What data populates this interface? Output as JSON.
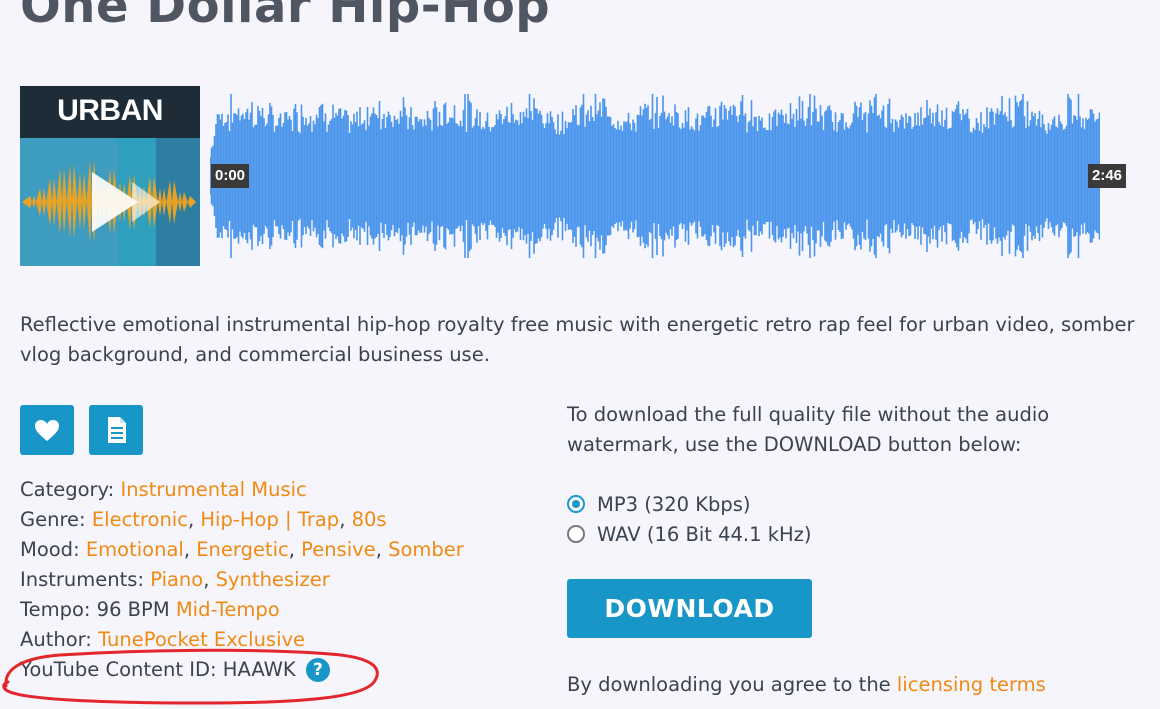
{
  "track": {
    "title": "One Dollar Hip-Hop",
    "cover_text": "URBAN",
    "time_start": "0:00",
    "time_end": "2:46",
    "description": "Reflective emotional instrumental hip-hop royalty free music with energetic retro rap feel for urban video, somber vlog background, and commercial business use."
  },
  "meta": {
    "category_label": "Category:",
    "category": "Instrumental Music",
    "genre_label": "Genre:",
    "genres": [
      "Electronic",
      "Hip-Hop | Trap",
      "80s"
    ],
    "mood_label": "Mood:",
    "moods": [
      "Emotional",
      "Energetic",
      "Pensive",
      "Somber"
    ],
    "instruments_label": "Instruments:",
    "instruments": [
      "Piano",
      "Synthesizer"
    ],
    "tempo_label": "Tempo:",
    "tempo_value": "96 BPM",
    "tempo_link": "Mid-Tempo",
    "author_label": "Author:",
    "author": "TunePocket Exclusive",
    "content_id_label": "YouTube Content ID:",
    "content_id": "HAAWK",
    "help_glyph": "?",
    "separator": ","
  },
  "download": {
    "info": "To download the full quality file without the audio watermark, use the DOWNLOAD button below:",
    "options": [
      {
        "label": "MP3 (320 Kbps)",
        "selected": true
      },
      {
        "label": "WAV (16 Bit 44.1 kHz)",
        "selected": false
      }
    ],
    "button_label": "DOWNLOAD",
    "terms_prefix": "By downloading you agree to the",
    "terms_link": "licensing terms"
  },
  "colors": {
    "accent": "#1996c8",
    "link": "#f08a13",
    "waveform": "#4a95ec",
    "annotation": "#e3262b"
  },
  "icons": [
    "heart-icon",
    "document-icon",
    "play-icon",
    "question-icon"
  ]
}
